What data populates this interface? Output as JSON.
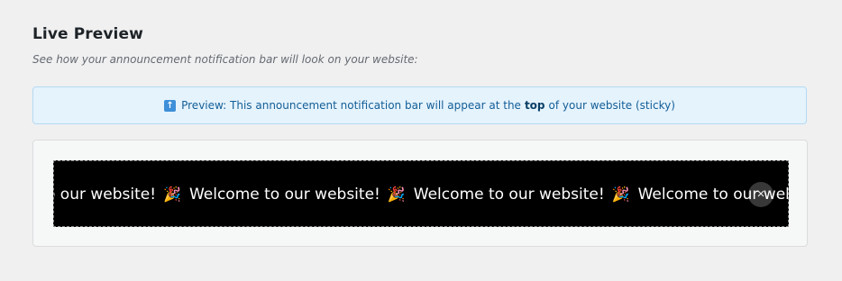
{
  "section": {
    "title": "Live Preview",
    "subtitle": "See how your announcement notification bar will look on your website:"
  },
  "notice": {
    "icon": "up-arrow-icon",
    "prefix": "Preview: This announcement notification bar will appear at the",
    "position": "top",
    "suffix": "of your website (sticky)",
    "background": "#e5f3fd",
    "text_color": "#135e96"
  },
  "bar": {
    "background": "#000000",
    "text_color": "#ffffff",
    "segments": [
      {
        "text": "o our website!"
      },
      {
        "text": "Welcome to our website!"
      },
      {
        "text": "Welcome to our website!"
      },
      {
        "text": "Welcome to our website!"
      }
    ],
    "separator_icon": "party-popper-icon",
    "separator_glyph": "🎉",
    "close_glyph": "×"
  }
}
